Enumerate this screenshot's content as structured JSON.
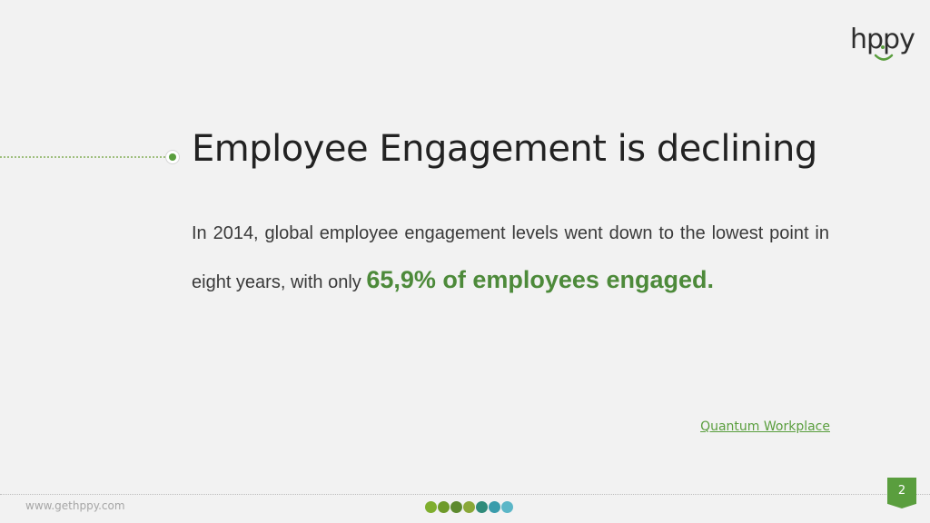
{
  "brand": {
    "logo_text": "hppy",
    "accent_color": "#5a9e3e",
    "icon": "smile-logo-icon"
  },
  "slide": {
    "title": "Employee Engagement is declining",
    "body_plain": "In 2014, global employee engagement levels went down to the lowest point in eight years, with only ",
    "body_highlight": "65,9% of employees engaged.",
    "source_label": "Quantum Workplace",
    "page_number": "2"
  },
  "footer": {
    "url": "www.gethppy.com",
    "dot_colors": [
      "#7fae2e",
      "#6e9a2a",
      "#5d8a2e",
      "#8aa838",
      "#2f8b7a",
      "#3a9cab",
      "#5bb6c7"
    ]
  }
}
